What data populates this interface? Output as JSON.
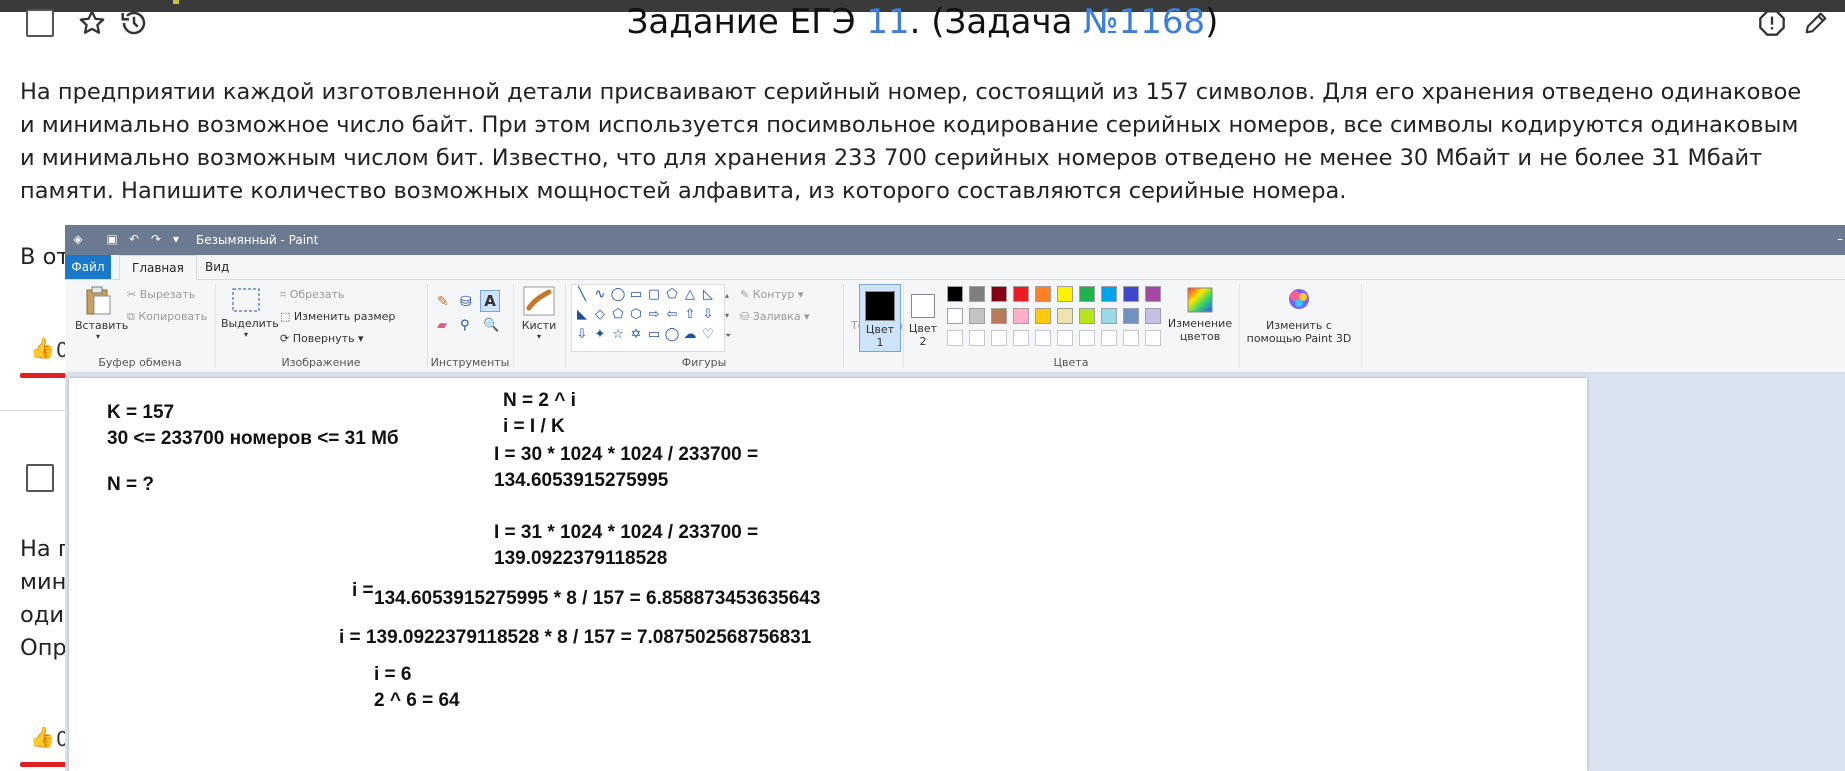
{
  "page": {
    "title_prefix": "Задание ЕГЭ ",
    "title_task_link": "11",
    "title_mid": ". (Задача ",
    "title_problem_link": "№1168",
    "title_suffix": ")",
    "task_text": "На предприятии каждой изготовленной детали присваивают серийный номер, состоящий из 157 символов. Для его хранения отведено одинаковое и минимально возможное число байт. При этом используется посимвольное кодирование серийных номеров, все символы кодируются одинаковым и минимально возможным числом бит. Известно, что для хранения 233 700 серийных номеров отведено не менее 30 Мбайт и  не более 31 Мбайт памяти. Напишите количество возможных мощностей алфавита, из которого составляются серийные номера.",
    "answer_fragment": "В от",
    "like_count_1": "0",
    "like_count_2": "0",
    "next_lines": [
      "На п",
      "мин",
      "оди",
      "Опр"
    ]
  },
  "paint": {
    "window_title": "Безымянный - Paint",
    "tabs": [
      "Файл",
      "Главная",
      "Вид"
    ],
    "clipboard": {
      "paste": "Вставить",
      "cut": "Вырезать",
      "copy": "Копировать",
      "group": "Буфер обмена"
    },
    "image": {
      "select": "Выделить",
      "crop": "Обрезать",
      "resize": "Изменить размер",
      "rotate": "Повернуть",
      "group": "Изображение"
    },
    "tools": {
      "group": "Инструменты"
    },
    "brushes": {
      "label": "Кисти"
    },
    "shapes": {
      "outline": "Контур",
      "fill": "Заливка",
      "group": "Фигуры"
    },
    "size": {
      "label": "Толщина"
    },
    "colors": {
      "color1": "Цвет",
      "color1_num": "1",
      "color2": "Цвет",
      "color2_num": "2",
      "edit": "Изменение",
      "edit2": "цветов",
      "paint3d": "Изменить с",
      "paint3d2": "помощью Paint 3D",
      "group": "Цвета",
      "palette_row1": [
        "#000000",
        "#7f7f7f",
        "#880015",
        "#ed1c24",
        "#ff7f27",
        "#fff200",
        "#22b14c",
        "#00a2e8",
        "#3f48cc",
        "#a349a4"
      ],
      "palette_row2": [
        "#ffffff",
        "#c3c3c3",
        "#b97a57",
        "#ffaec9",
        "#ffc90e",
        "#efe4b0",
        "#b5e61d",
        "#99d9ea",
        "#7092be",
        "#c8bfe7"
      ]
    },
    "canvas_text": {
      "k": "K = 157",
      "range": "30 <= 233700 номеров <= 31 Мб",
      "n_q": "N = ?",
      "n_formula": "N = 2 ^ i",
      "i_formula": "i = I / K",
      "i1_expr": "I = 30 * 1024 * 1024 / 233700 =",
      "i1_val": "134.6053915275995",
      "i2_expr": "I = 31 * 1024 * 1024 / 233700 =",
      "i2_val": "139.0922379118528",
      "i_eq": "i =",
      "calc1": "134.6053915275995 * 8 / 157 = 6.858873453635643",
      "calc2": "i = 139.0922379118528 * 8 / 157 = 7.087502568756831",
      "i_res": "i = 6",
      "n_res": "2 ^ 6 = 64"
    }
  }
}
